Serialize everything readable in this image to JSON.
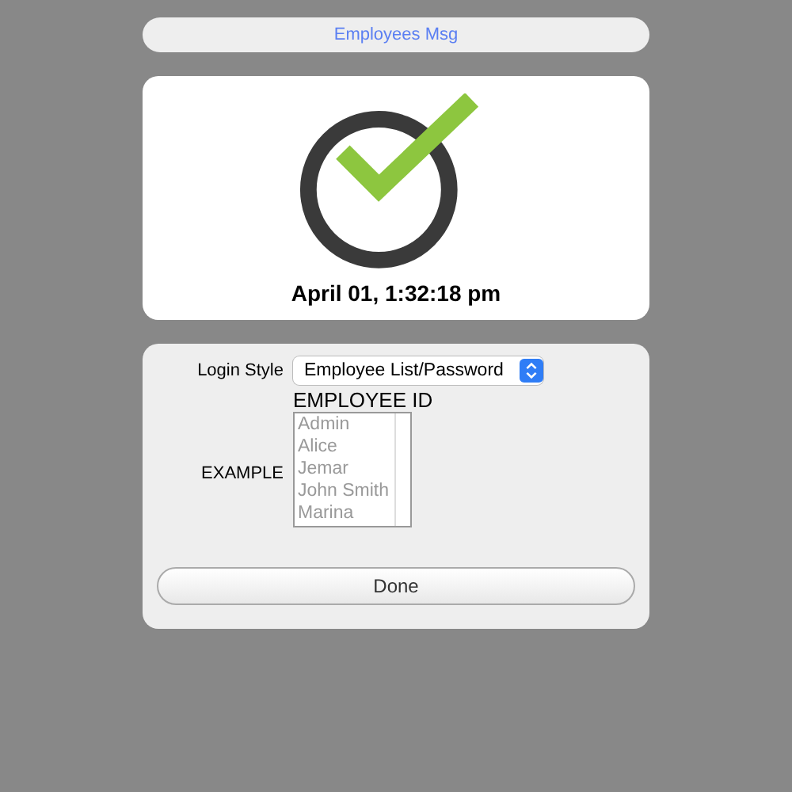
{
  "header": {
    "title": "Employees Msg"
  },
  "status": {
    "timestamp": "April 01, 1:32:18 pm"
  },
  "settings": {
    "login_style_label": "Login Style",
    "login_style_value": "Employee List/Password",
    "example_label": "EXAMPLE",
    "list_heading": "EMPLOYEE ID",
    "employees": [
      "Admin",
      "Alice",
      "Jemar",
      "John Smith",
      "Marina"
    ]
  },
  "buttons": [
    "Done"
  ]
}
